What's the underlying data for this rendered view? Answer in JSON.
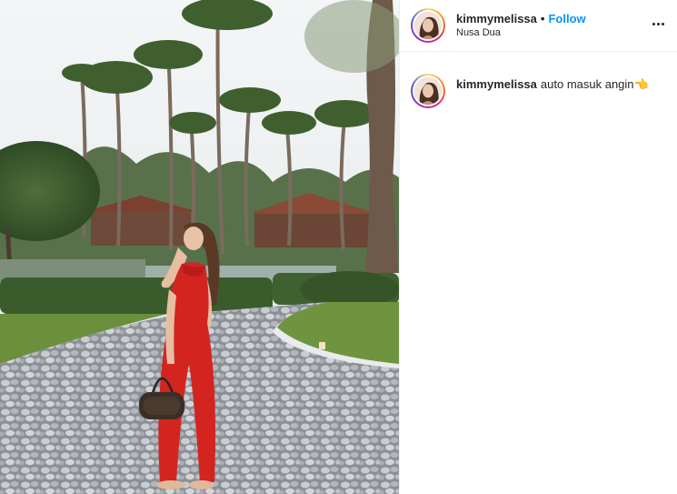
{
  "post": {
    "username": "kimmymelissa",
    "separator": "•",
    "follow_label": "Follow",
    "location": "Nusa Dua",
    "caption_username": "kimmymelissa",
    "caption_text": "auto masuk angin👈",
    "more_icon": "more-horizontal-icon",
    "photo_subject": "woman in red halter jumpsuit on pebble path with palm trees"
  },
  "colors": {
    "accent": "#0095f6",
    "text": "#262626",
    "divider": "#efefef"
  }
}
